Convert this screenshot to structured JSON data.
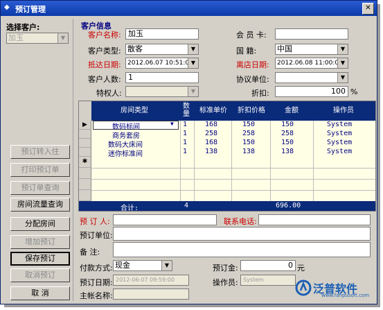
{
  "window": {
    "title": "预订管理",
    "close_glyph": "✕"
  },
  "left": {
    "select_label": "选择客户:",
    "select_value": "加玉",
    "buttons": [
      "预订转入住",
      "打印预订单",
      "预订单查询",
      "房间流量查询",
      "分配房间",
      "增加预订",
      "保存预订",
      "取消预订",
      "取 消"
    ]
  },
  "customer": {
    "section_title": "客户信息",
    "name_label": "客户名称:",
    "name_value": "加玉",
    "card_label": "会 员 卡:",
    "card_value": "",
    "type_label": "客户类型:",
    "type_value": "散客",
    "nation_label": "国 籍:",
    "nation_value": "中国",
    "arrive_label": "抵达日期:",
    "arrive_value": "2012.06.07 10:51:00",
    "leave_label": "离店日期:",
    "leave_value": "2012.06.08 11:00:00",
    "count_label": "客户人数:",
    "count_value": "1",
    "agreement_label": "协议单位:",
    "agreement_value": "",
    "privilege_label": "特权人:",
    "privilege_value": "",
    "discount_label": "折扣:",
    "discount_value": "100",
    "discount_unit": "%"
  },
  "grid": {
    "columns": [
      "房间类型",
      "数量",
      "标准单价",
      "折扣价格",
      "金额",
      "操作员"
    ],
    "rows": [
      {
        "type": "数码标间",
        "qty": "1",
        "price": "168",
        "disc": "150",
        "amount": "150",
        "op": "System"
      },
      {
        "type": "商务套房",
        "qty": "1",
        "price": "258",
        "disc": "258",
        "amount": "258",
        "op": "System"
      },
      {
        "type": "数码大床间",
        "qty": "1",
        "price": "168",
        "disc": "150",
        "amount": "150",
        "op": "System"
      },
      {
        "type": "迷你标准间",
        "qty": "1",
        "price": "138",
        "disc": "138",
        "amount": "138",
        "op": "System"
      }
    ],
    "footer": {
      "label": "合计:",
      "qty": "4",
      "amount": "696.00"
    },
    "current_marker": "▶",
    "new_marker": "✱"
  },
  "booking": {
    "person_label": "预 订 人:",
    "person_value": "",
    "phone_label": "联系电话:",
    "phone_value": "",
    "unit_label": "预订单位:",
    "unit_value": "",
    "note_label": "备 注:",
    "note_value": "",
    "pay_label": "付款方式:",
    "pay_value": "现金",
    "deposit_label": "预订金:",
    "deposit_value": "0",
    "deposit_unit": "元",
    "date_label": "预订日期:",
    "date_value": "2012-06-07 09:59:00",
    "operator_label": "操作员:",
    "operator_value": "System",
    "account_label": "主帐名称:",
    "account_value": ""
  },
  "logo": {
    "text": "泛普软件",
    "url": "www.fanpusoft.com"
  }
}
